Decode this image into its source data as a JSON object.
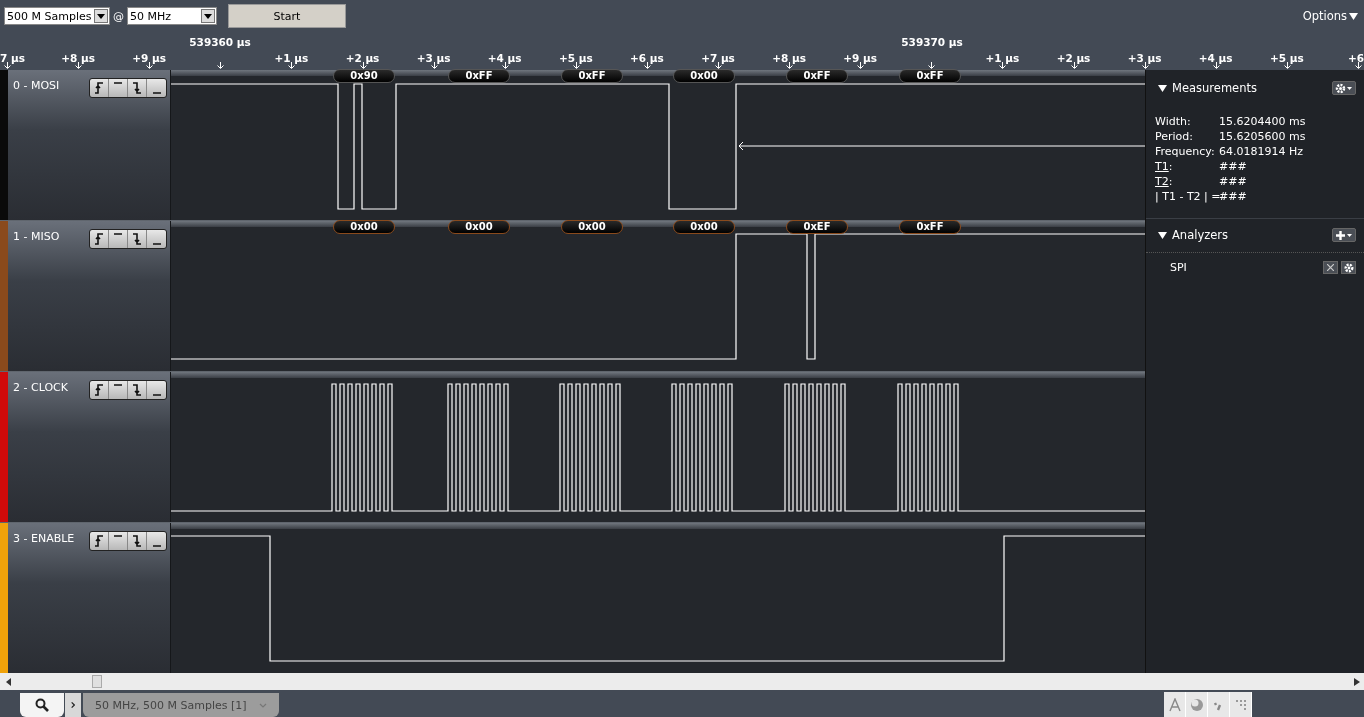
{
  "toolbar": {
    "samples": "500 M Samples",
    "at": "@",
    "rate": "50 MHz",
    "start": "Start",
    "options": "Options"
  },
  "ruler": {
    "major": [
      "539360 µs",
      "539370 µs"
    ],
    "ticks": [
      "7 µs",
      "+8 µs",
      "+9 µs",
      "+1 µs",
      "+2 µs",
      "+3 µs",
      "+4 µs",
      "+5 µs",
      "+6 µs",
      "+7 µs",
      "+8 µs",
      "+9 µs",
      "+1 µs",
      "+2 µs",
      "+3 µs",
      "+4 µs",
      "+5 µs",
      "+6"
    ]
  },
  "channels": [
    {
      "name": "0 - MOSI",
      "color": "#0a0a0a",
      "decoded": [
        "0x90",
        "0xFF",
        "0xFF",
        "0x00",
        "0xFF",
        "0xFF"
      ]
    },
    {
      "name": "1 - MISO",
      "color": "#8a4a1c",
      "decoded": [
        "0x00",
        "0x00",
        "0x00",
        "0x00",
        "0xEF",
        "0xFF"
      ]
    },
    {
      "name": "2 - CLOCK",
      "color": "#d00a0a"
    },
    {
      "name": "3 - ENABLE",
      "color": "#f0a20a"
    }
  ],
  "measurements": {
    "title": "Measurements",
    "rows": [
      {
        "label": "Width:",
        "value": "15.6204400 ms",
        "kind": "plain"
      },
      {
        "label": "Period:",
        "value": "15.6205600 ms",
        "kind": "plain"
      },
      {
        "label": "Frequency:",
        "value": "64.0181914 Hz",
        "kind": "plain"
      },
      {
        "label": "T1",
        "suffix": ":",
        "value": "###",
        "kind": "link"
      },
      {
        "label": "T2",
        "suffix": ":",
        "value": "###",
        "kind": "link"
      },
      {
        "label": "| T1 - T2 | =",
        "value": "###",
        "kind": "plain"
      }
    ]
  },
  "analyzers": {
    "title": "Analyzers",
    "items": [
      "SPI"
    ]
  },
  "tabs": [
    "50 MHz, 500 M Samples [1]"
  ]
}
